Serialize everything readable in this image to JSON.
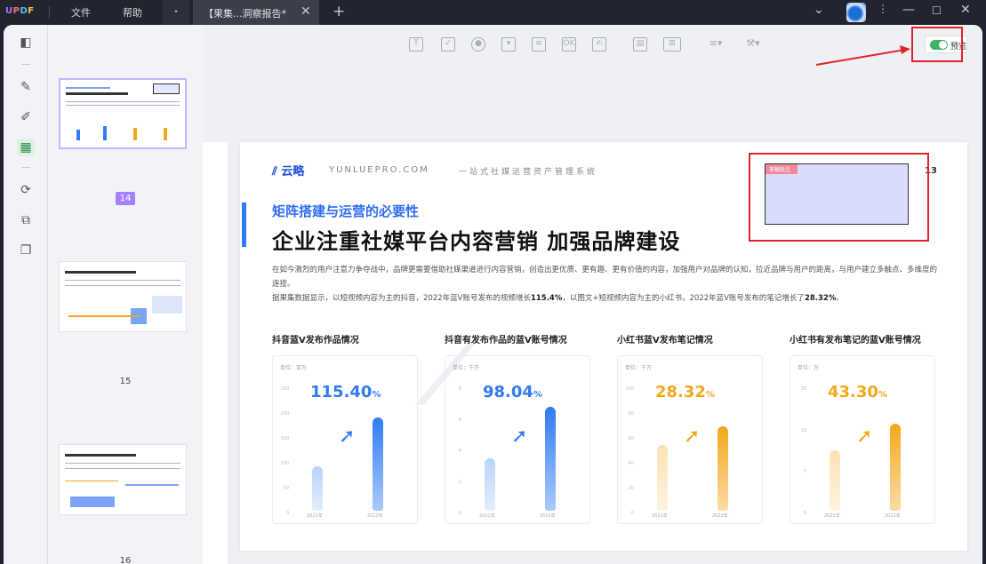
{
  "titlebar": {
    "logo": "UPDF",
    "menu_file": "文件",
    "menu_help": "帮助",
    "tab_title": "【果集...洞察报告*"
  },
  "sidebar": {
    "pages": [
      "14",
      "15",
      "16"
    ]
  },
  "toolbar": {
    "preview_label": "预览"
  },
  "document": {
    "brand": "云略",
    "brand_en": "YUNLUEPRO.COM",
    "brand_sub": "一站式社媒运营资产管理系统",
    "page_number": "13",
    "stamp_label": "草稿批注",
    "subtitle": "矩阵搭建与运营的必要性",
    "title": "企业注重社媒平台内容营销  加强品牌建设",
    "para1": "在如今激烈的用户注意力争夺战中，品牌更需要借助社媒渠道进行内容营销，创造出更优质、更有趣、更有价值的内容，加强用户对品牌的认知，拉近品牌与用户的距离，与用户建立多触点、多维度的连接。",
    "para2a": "据果集数据显示，以短视频内容为主的抖音，2022年蓝V账号发布的视频增长",
    "para2b": "115.4%",
    "para2c": "，以图文+短视频内容为主的小红书，2022年蓝V账号发布的笔记增长了",
    "para2d": "28.32%",
    "para2e": "。"
  },
  "charts": [
    {
      "title": "抖音蓝V发布作品情况",
      "unit": "单位：百万",
      "big": "115.40",
      "pct": "%",
      "ticks": [
        "250",
        "200",
        "150",
        "100",
        "50",
        "0"
      ],
      "years": [
        "2021年",
        "2022年"
      ],
      "values": [
        0.42,
        0.88
      ],
      "color": "#2f7bf5"
    },
    {
      "title": "抖音有发布作品的蓝V账号情况",
      "unit": "单位：千万",
      "big": "98.04",
      "pct": "%",
      "ticks": [
        "8",
        "6",
        "4",
        "2",
        "0"
      ],
      "years": [
        "2021年",
        "2022年"
      ],
      "values": [
        0.5,
        0.98
      ],
      "color": "#2f7bf5"
    },
    {
      "title": "小红书蓝V发布笔记情况",
      "unit": "单位：千万",
      "big": "28.32",
      "pct": "%",
      "ticks": [
        "100",
        "80",
        "60",
        "40",
        "20",
        "0"
      ],
      "years": [
        "2021年",
        "2022年"
      ],
      "values": [
        0.62,
        0.8
      ],
      "color": "#f3a81c"
    },
    {
      "title": "小红书有发布笔记的蓝V账号情况",
      "unit": "单位：万",
      "big": "43.30",
      "pct": "%",
      "ticks": [
        "15",
        "10",
        "5",
        "0"
      ],
      "years": [
        "2021年",
        "2022年"
      ],
      "values": [
        0.57,
        0.82
      ],
      "color": "#f3a81c"
    }
  ],
  "colors": {
    "accent": "#2f7bf5",
    "highlight": "#e2232a",
    "orange": "#f3a81c",
    "toggle": "#3bb561"
  }
}
